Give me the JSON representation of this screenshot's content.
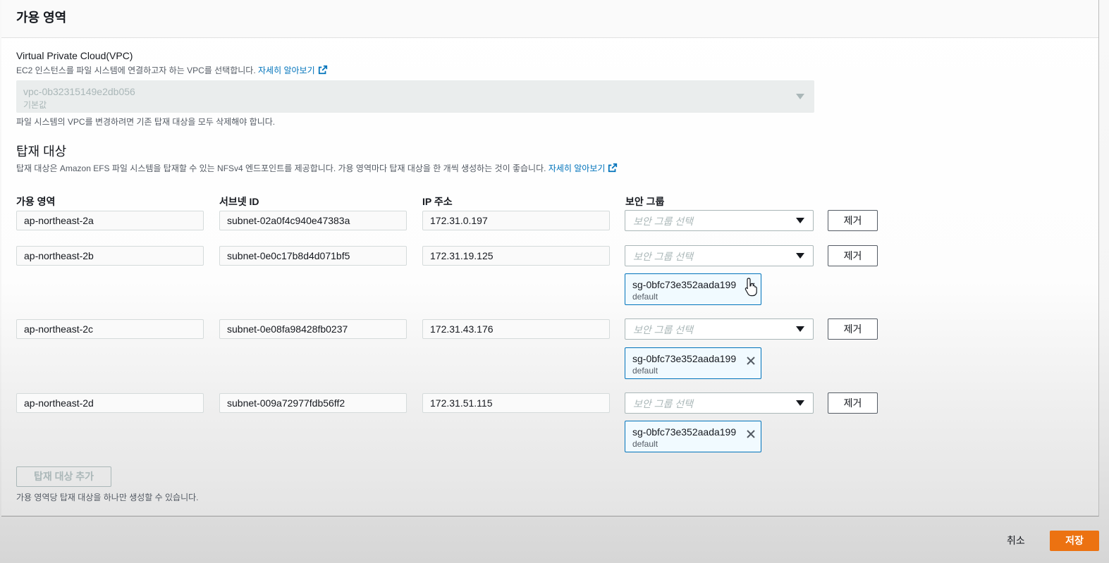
{
  "panel": {
    "title": "가용 영역"
  },
  "vpc": {
    "label": "Virtual Private Cloud(VPC)",
    "description": "EC2 인스턴스를 파일 시스템에 연결하고자 하는 VPC를 선택합니다.",
    "learn_more": "자세히 알아보기",
    "selected_value": "vpc-0b32315149e2db056",
    "selected_sub": "기본값",
    "hint": "파일 시스템의 VPC를 변경하려면 기존 탑재 대상을 모두 삭제해야 합니다."
  },
  "mount_targets": {
    "title": "탑재 대상",
    "description": "탑재 대상은 Amazon EFS 파일 시스템을 탑재할 수 있는 NFSv4 엔드포인트를 제공합니다. 가용 영역마다 탑재 대상을 한 개씩 생성하는 것이 좋습니다.",
    "learn_more": "자세히 알아보기",
    "columns": {
      "az": "가용 영역",
      "subnet": "서브넷 ID",
      "ip": "IP 주소",
      "sg": "보안 그룹"
    },
    "sg_placeholder": "보안 그룹 선택",
    "remove_label": "제거",
    "rows": [
      {
        "az": "ap-northeast-2a",
        "subnet": "subnet-02a0f4c940e47383a",
        "ip": "172.31.0.197"
      },
      {
        "az": "ap-northeast-2b",
        "subnet": "subnet-0e0c17b8d4d071bf5",
        "ip": "172.31.19.125",
        "token": {
          "id": "sg-0bfc73e352aada199",
          "name": "default"
        }
      },
      {
        "az": "ap-northeast-2c",
        "subnet": "subnet-0e08fa98428fb0237",
        "ip": "172.31.43.176",
        "token": {
          "id": "sg-0bfc73e352aada199",
          "name": "default"
        }
      },
      {
        "az": "ap-northeast-2d",
        "subnet": "subnet-009a72977fdb56ff2",
        "ip": "172.31.51.115",
        "token": {
          "id": "sg-0bfc73e352aada199",
          "name": "default"
        }
      }
    ],
    "add_button": "탑재 대상 추가",
    "add_hint": "가용 영역당 탑재 대상을 하나만 생성할 수 있습니다."
  },
  "footer": {
    "cancel": "취소",
    "save": "저장"
  },
  "colors": {
    "link": "#0073bb",
    "primary": "#ec7211",
    "token_border": "#0073bb"
  }
}
